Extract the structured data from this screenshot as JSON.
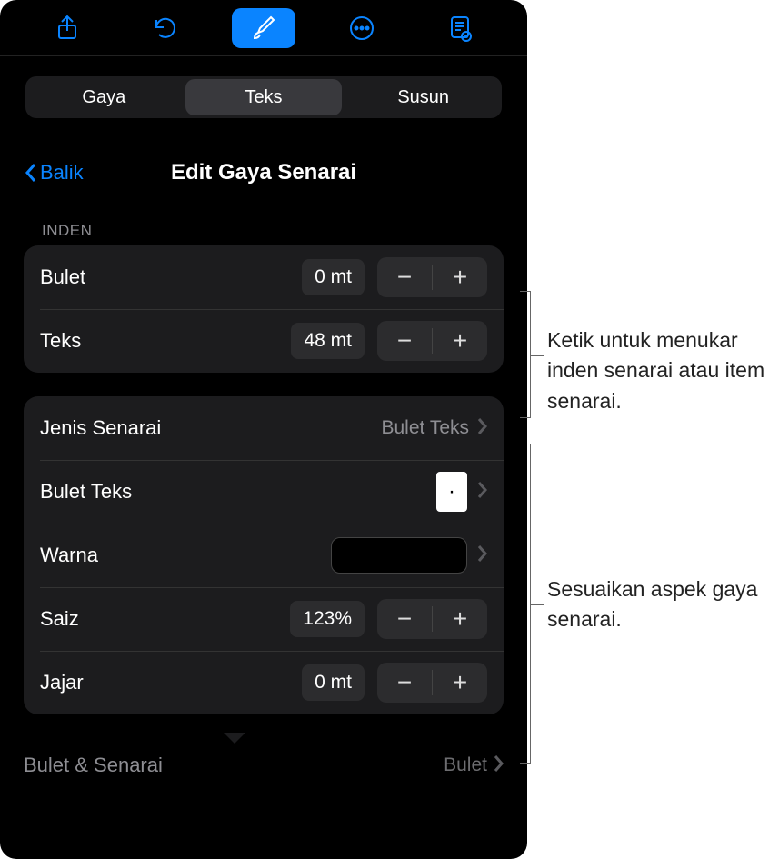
{
  "toolbar": {
    "icons": [
      "share-icon",
      "undo-icon",
      "brush-icon",
      "more-icon",
      "document-icon"
    ]
  },
  "segmented": {
    "items": [
      "Gaya",
      "Teks",
      "Susun"
    ],
    "active_index": 1
  },
  "panel": {
    "back_label": "Balik",
    "title": "Edit Gaya Senarai"
  },
  "inden": {
    "section_label": "INDEN",
    "rows": [
      {
        "label": "Bulet",
        "value": "0 mt"
      },
      {
        "label": "Teks",
        "value": "48 mt"
      }
    ]
  },
  "style_rows": {
    "jenis_senarai": {
      "label": "Jenis Senarai",
      "value": "Bulet Teks"
    },
    "bulet_teks": {
      "label": "Bulet Teks",
      "preview": "·"
    },
    "warna": {
      "label": "Warna",
      "color": "#000000"
    },
    "saiz": {
      "label": "Saiz",
      "value": "123%"
    },
    "jajar": {
      "label": "Jajar",
      "value": "0 mt"
    }
  },
  "footer": {
    "label": "Bulet & Senarai",
    "value": "Bulet"
  },
  "stepper": {
    "minus": "−",
    "plus": "+"
  },
  "callouts": {
    "inden": "Ketik untuk menukar inden senarai atau item senarai.",
    "style": "Sesuaikan aspek gaya senarai."
  }
}
